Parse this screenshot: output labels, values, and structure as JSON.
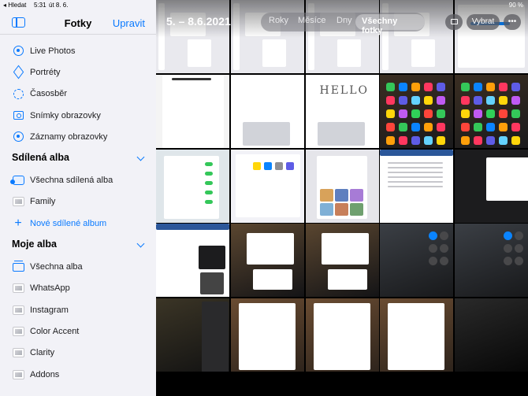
{
  "status_bar": {
    "back_label": "◂ Hledat",
    "time": "5:31",
    "date": "út 8. 6.",
    "battery": "90 %"
  },
  "sidebar": {
    "title": "Fotky",
    "edit_label": "Upravit",
    "media_types": [
      {
        "label": "Live Photos",
        "icon": "live-photos-icon"
      },
      {
        "label": "Portréty",
        "icon": "cube-icon"
      },
      {
        "label": "Časosběr",
        "icon": "timelapse-icon"
      },
      {
        "label": "Snímky obrazovky",
        "icon": "screenshot-icon"
      },
      {
        "label": "Záznamy obrazovky",
        "icon": "screen-record-icon"
      }
    ],
    "shared_section": {
      "title": "Sdílená alba",
      "items": [
        {
          "label": "Všechna sdílená alba",
          "icon": "shared-albums-icon"
        },
        {
          "label": "Family",
          "icon": "album-thumb-icon"
        },
        {
          "label": "Nové sdílené album",
          "icon": "plus-icon"
        }
      ]
    },
    "my_albums_section": {
      "title": "Moje alba",
      "items": [
        {
          "label": "Všechna alba",
          "icon": "all-albums-icon"
        },
        {
          "label": "WhatsApp",
          "icon": "album-thumb-icon"
        },
        {
          "label": "Instagram",
          "icon": "album-thumb-icon"
        },
        {
          "label": "Color Accent",
          "icon": "album-thumb-icon"
        },
        {
          "label": "Clarity",
          "icon": "album-thumb-icon"
        },
        {
          "label": "Addons",
          "icon": "album-thumb-icon"
        }
      ]
    }
  },
  "library": {
    "date_range": "5. – 8.6.2021",
    "view_tabs": [
      {
        "label": "Roky",
        "active": false
      },
      {
        "label": "Měsíce",
        "active": false
      },
      {
        "label": "Dny",
        "active": false
      },
      {
        "label": "Všechny fotky",
        "active": true
      }
    ],
    "select_label": "Vybrat",
    "more_icon": "ellipsis-icon",
    "slideshow_icon": "slideshow-icon",
    "photos": [
      {
        "kind": "settings-light"
      },
      {
        "kind": "settings-light"
      },
      {
        "kind": "settings-light"
      },
      {
        "kind": "settings-light"
      },
      {
        "kind": "settings-dark"
      },
      {
        "kind": "doc-light"
      },
      {
        "kind": "notes-blank"
      },
      {
        "kind": "notes-hello"
      },
      {
        "kind": "home-dark"
      },
      {
        "kind": "home-dark"
      },
      {
        "kind": "settings-toggles"
      },
      {
        "kind": "settings-colors"
      },
      {
        "kind": "wallpaper-picker"
      },
      {
        "kind": "word-doc"
      },
      {
        "kind": "dark-mini"
      },
      {
        "kind": "web-page"
      },
      {
        "kind": "multitask-dark"
      },
      {
        "kind": "multitask-dark"
      },
      {
        "kind": "control-center"
      },
      {
        "kind": "control-center-2"
      },
      {
        "kind": "dark-window"
      },
      {
        "kind": "blurred-wood"
      },
      {
        "kind": "blurred-wood"
      },
      {
        "kind": "blurred-wood"
      },
      {
        "kind": "dark-photo"
      }
    ],
    "text_hello": "HELLO"
  }
}
